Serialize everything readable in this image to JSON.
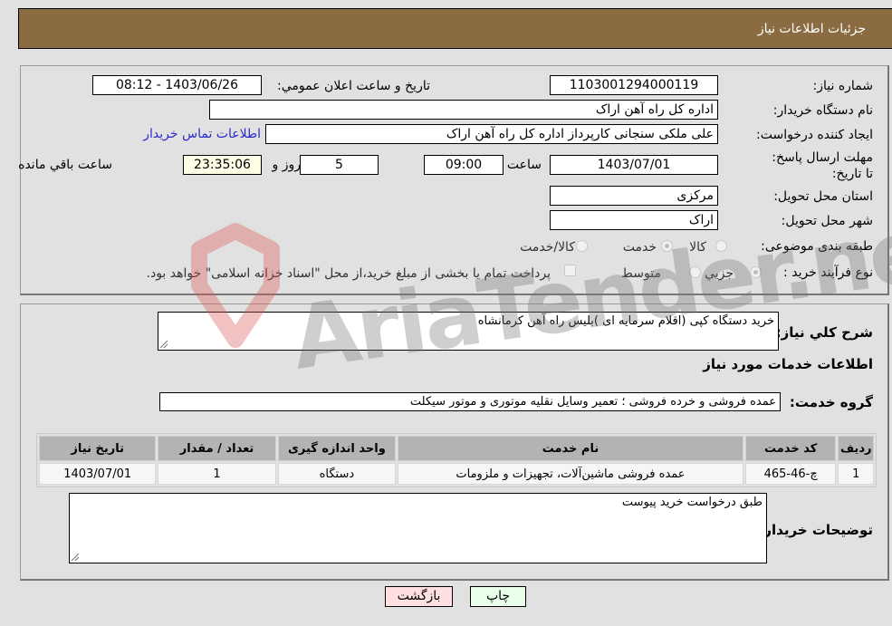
{
  "header": {
    "title": "جزئیات اطلاعات نیاز"
  },
  "details": {
    "need_number_label": "شماره نیاز:",
    "need_number": "1103001294000119",
    "announce_label": "تاریخ و ساعت اعلان عمومي:",
    "announce_value": "1403/06/26 - 08:12",
    "buyer_org_label": "نام دستگاه خریدار:",
    "buyer_org": "اداره کل راه آهن اراک",
    "creator_label": "ایجاد کننده درخواست:",
    "creator": "علی ملکی سنجانی کارپرداز اداره کل راه آهن اراک",
    "contact_link": "اطلاعات تماس خریدار",
    "deadline_label": "مهلت ارسال پاسخ: تا تاریخ:",
    "deadline_date": "1403/07/01",
    "time_label": "ساعت",
    "deadline_time": "09:00",
    "days": "5",
    "days_label": "روز و",
    "remaining": "23:35:06",
    "remaining_label": "ساعت باقي مانده",
    "province_label": "استان محل تحویل:",
    "province": "مرکزی",
    "city_label": "شهر محل تحویل:",
    "city": "اراک",
    "category_label": "طبقه بندی موضوعی:",
    "category_options": [
      {
        "label": "کالا",
        "selected": false
      },
      {
        "label": "خدمت",
        "selected": true
      },
      {
        "label": "کالا/خدمت",
        "selected": false
      }
    ],
    "process_label": "نوع فرآیند خرید :",
    "process_options": [
      {
        "label": "جزيي",
        "selected": true
      },
      {
        "label": "متوسط",
        "selected": false
      }
    ],
    "treasury_note": "پرداخت تمام یا بخشی از مبلغ خرید،از محل \"اسناد خزانه اسلامی\" خواهد بود.",
    "treasury_checked": false
  },
  "summary": {
    "description_label": "شرح کلي نیاز:",
    "description": "خرید دستگاه کپی (اقلام سرمایه ای )بلیس راه آهن کرمانشاه",
    "services_heading": "اطلاعات خدمات مورد نیاز",
    "service_group_label": "گروه خدمت:",
    "service_group": "عمده فروشی و خرده فروشی ؛ تعمیر وسایل نقلیه موتوری و موتور سیکلت"
  },
  "table": {
    "headers": [
      "ردیف",
      "کد خدمت",
      "نام خدمت",
      "واحد اندازه گیری",
      "تعداد / مقدار",
      "تاریخ نیاز"
    ],
    "rows": [
      [
        "1",
        "چ-46-465",
        "عمده فروشی ماشین‌آلات، تجهیزات و ملزومات",
        "دستگاه",
        "1",
        "1403/07/01"
      ]
    ]
  },
  "buyer_notes": {
    "label": "توضیحات خریدار:",
    "value": "طبق درخواست خرید پیوست"
  },
  "buttons": {
    "print": "چاپ",
    "back": "بازگشت"
  },
  "watermark": {
    "text": "AriaTender.neT"
  }
}
